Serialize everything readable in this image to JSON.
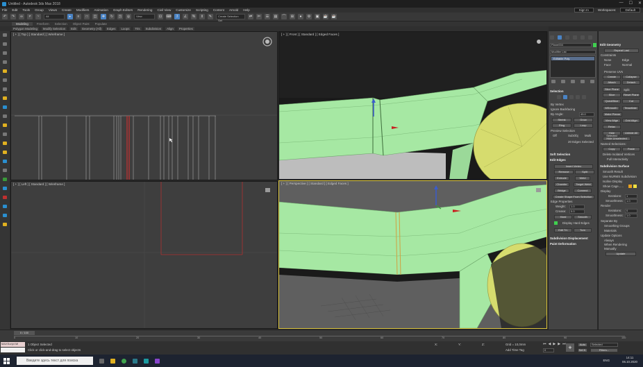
{
  "window": {
    "title": "Untitled - Autodesk 3ds Max 2018",
    "controls": [
      "—",
      "☐",
      "✕"
    ]
  },
  "menu": {
    "items": [
      "File",
      "Edit",
      "Tools",
      "Group",
      "Views",
      "Create",
      "Modifiers",
      "Animation",
      "Graph Editors",
      "Rendering",
      "Civil View",
      "Customize",
      "Scripting",
      "Content",
      "Arnold",
      "Help"
    ],
    "sign_in": "Sign In",
    "workspaces_label": "Workspaces:",
    "workspace_value": "Default"
  },
  "toolbar": {
    "filter_value": "All",
    "view_value": "View",
    "selection_set_placeholder": "Create Selection Set"
  },
  "ribbon": {
    "tabs": [
      "Modeling",
      "Freeform",
      "Selection",
      "Object Paint",
      "Populate"
    ],
    "active_tab": "Modeling",
    "items": [
      "Polygon Modeling",
      "Modify Selection",
      "Edit",
      "Geometry (All)",
      "Edges",
      "Loops",
      "Tris",
      "Subdivision",
      "Align",
      "Properties"
    ]
  },
  "viewports": {
    "top": "[ + ] [ Top ] [ Standard ] [ Wireframe ]",
    "front": "[ + ] [ Front ] [ Standard ] [ Edged Faces ]",
    "left": "[ + ] [ Left ] [ Standard ] [ Wireframe ]",
    "perspective": "[ + ] [ Perspective ] [ Standard ] [ Edged Faces ]"
  },
  "command_panel": {
    "object_name": "Plane004",
    "modifier_list": "Modifier List",
    "stack_item": "Editable Poly",
    "selection": {
      "title": "Selection",
      "by_vertex": "By Vertex",
      "ignore_backfacing": "Ignore Backfacing",
      "by_angle": "By Angle:",
      "by_angle_value": "45.0",
      "shrink": "Shrink",
      "grow": "Grow",
      "ring": "Ring",
      "loop": "Loop",
      "preview_selection": "Preview Selection",
      "preview_off": "Off",
      "preview_subobj": "SubObj",
      "preview_multi": "Multi",
      "status": "20 Edges Selected"
    },
    "soft_selection": "Soft Selection",
    "edit_edges": {
      "title": "Edit Edges",
      "insert_vertex": "Insert Vertex",
      "remove": "Remove",
      "split": "Split",
      "extrude": "Extrude",
      "weld": "Weld",
      "chamfer": "Chamfer",
      "target_weld": "Target Weld",
      "bridge": "Bridge",
      "connect": "Connect",
      "create_shape": "Create Shape From Selection",
      "edge_properties": "Edge Properties",
      "weight_label": "Weight:",
      "weight_value": "1.0",
      "crease_label": "Crease:",
      "crease_value": "0.0",
      "hard": "Hard",
      "smooth": "Smooth",
      "display_hard_edges": "Display Hard Edges",
      "edit_tri": "Edit Tri.",
      "turn": "Turn"
    },
    "subdivision_displacement": "Subdivision Displacement",
    "paint_deformation": "Paint Deformation"
  },
  "edit_geometry": {
    "title": "Edit Geometry",
    "repeat_last": "Repeat Last",
    "constraints_label": "Constraints",
    "c_none": "None",
    "c_edge": "Edge",
    "c_face": "Face",
    "c_normal": "Normal",
    "preserve_uvs": "Preserve UVs",
    "create": "Create",
    "collapse": "Collapse",
    "attach": "Attach",
    "detach": "Detach",
    "slice_plane": "Slice Plane",
    "split": "Split",
    "slice": "Slice",
    "reset_plane": "Reset Plane",
    "quickslice": "QuickSlice",
    "cut": "Cut",
    "msmooth": "MSmooth",
    "tessellate": "Tessellate",
    "make_planar": "Make Planar",
    "view_align": "View Align",
    "grid_align": "Grid Align",
    "relax": "Relax",
    "hide_selected": "Hide Selected",
    "unhide_all": "Unhide All",
    "hide_unselected": "Hide Unselected",
    "named_selections": "Named Selections:",
    "copy": "Copy",
    "paste": "Paste",
    "delete_isolated": "Delete Isolated Vertices",
    "full_interactivity": "Full Interactivity"
  },
  "subdivision_surface": {
    "title": "Subdivision Surface",
    "smooth_result": "Smooth Result",
    "use_nurms": "Use NURMS Subdivision",
    "isoline_display": "Isoline Display",
    "show_cage": "Show Cage......",
    "display_label": "Display",
    "iterations_label": "Iterations:",
    "iterations_value": "1",
    "smoothness_label": "Smoothness:",
    "smoothness_value": "1.0",
    "render_label": "Render",
    "r_iterations_value": "0",
    "r_smoothness_value": "1.0",
    "separate_by": "Separate By",
    "smoothing_groups": "Smoothing Groups",
    "materials": "Materials",
    "update_options": "Update Options",
    "always": "Always",
    "when_rendering": "When Rendering",
    "manually": "Manually",
    "update": "Update",
    "cage_colors": [
      "#e8a020",
      "#f0e040"
    ]
  },
  "timeline": {
    "frame_display": "0 / 100",
    "ticks": [
      "0",
      "10",
      "20",
      "30",
      "40",
      "50",
      "60",
      "70",
      "80",
      "90",
      "100"
    ]
  },
  "status": {
    "maxscript": "MAXScript Mi",
    "objects_selected": "1 Object Selected",
    "prompt": "Click or click-and-drag to select objects",
    "x_label": "X:",
    "y_label": "Y:",
    "z_label": "Z:",
    "grid": "Grid = 10,0mm",
    "add_time_tag": "Add Time Tag",
    "frame_value": "0",
    "auto_key": "Auto",
    "set_key": "Set K.",
    "key_mode": "Selected",
    "filters": "Filters..."
  },
  "taskbar": {
    "search_placeholder": "Введите здесь текст для поиска",
    "time": "14:11",
    "date": "06.10.2020",
    "lang": "ENG"
  },
  "colors": {
    "mesh": "#a4e8a0",
    "mesh_yellow": "#d6dc6e",
    "accent_blue": "#4a83c4",
    "active_viewport_border": "#d9c23a"
  }
}
